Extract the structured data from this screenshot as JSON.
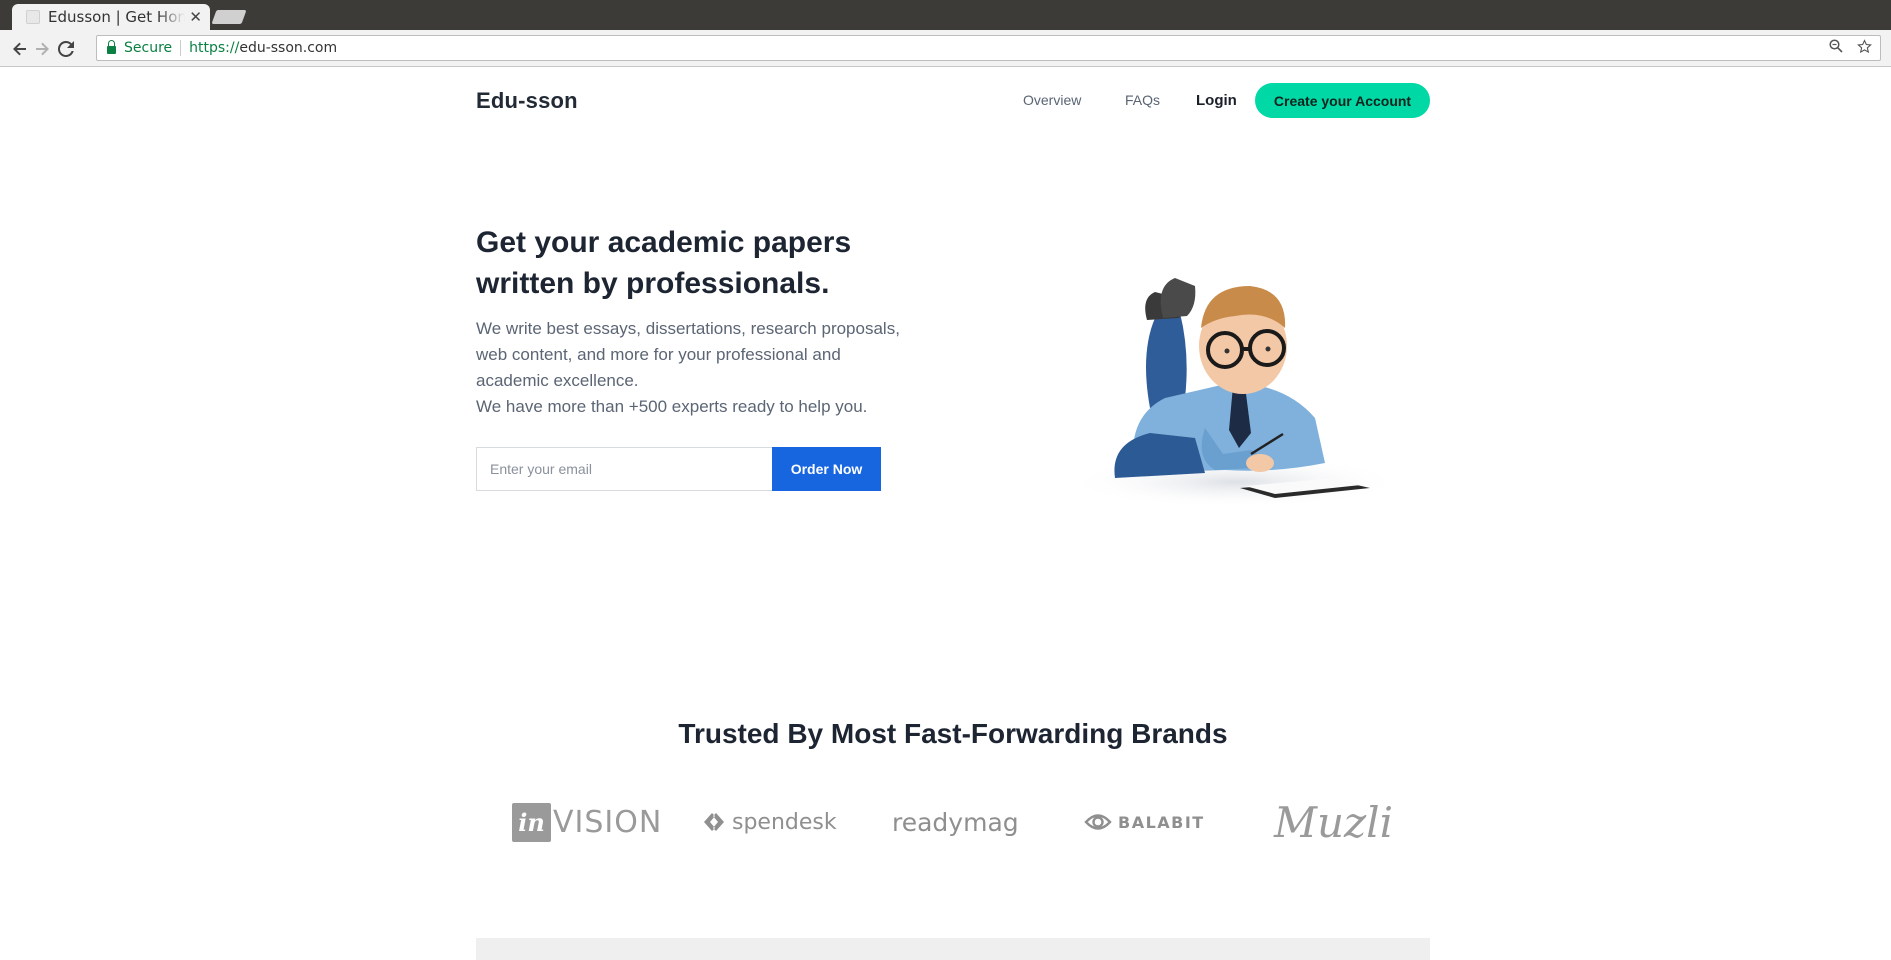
{
  "browser": {
    "tab_title": "Edusson | Get Home",
    "tab_close": "✕",
    "secure_label": "Secure",
    "url_scheme": "https://",
    "url_host": "edu-sson.com"
  },
  "header": {
    "brand": "Edu-sson",
    "nav": [
      {
        "label": "Overview"
      },
      {
        "label": "FAQs"
      },
      {
        "label": "Login"
      }
    ],
    "cta_label": "Create your Account"
  },
  "hero": {
    "title_line1": "Get your academic papers",
    "title_line2": "written by professionals.",
    "desc_lines": [
      "We write best essays, dissertations, research proposals,",
      "web content, and more for your professional and",
      "academic excellence.",
      "We have more than +500 experts ready to help you."
    ],
    "email_placeholder": "Enter your email",
    "order_label": "Order Now"
  },
  "brands": {
    "title": "Trusted By Most Fast-Forwarding Brands",
    "logos": [
      {
        "name": "invision",
        "box": "in",
        "rest": "VISION"
      },
      {
        "name": "spendesk",
        "text": "spendesk"
      },
      {
        "name": "readymag",
        "text": "readymag"
      },
      {
        "name": "balabit",
        "text": "BALABIT"
      },
      {
        "name": "muzli",
        "text": "Muzli"
      }
    ]
  },
  "colors": {
    "accent": "#00d8a5",
    "primary": "#1865e0",
    "heading": "#1e2532",
    "secure": "#0b8043"
  }
}
